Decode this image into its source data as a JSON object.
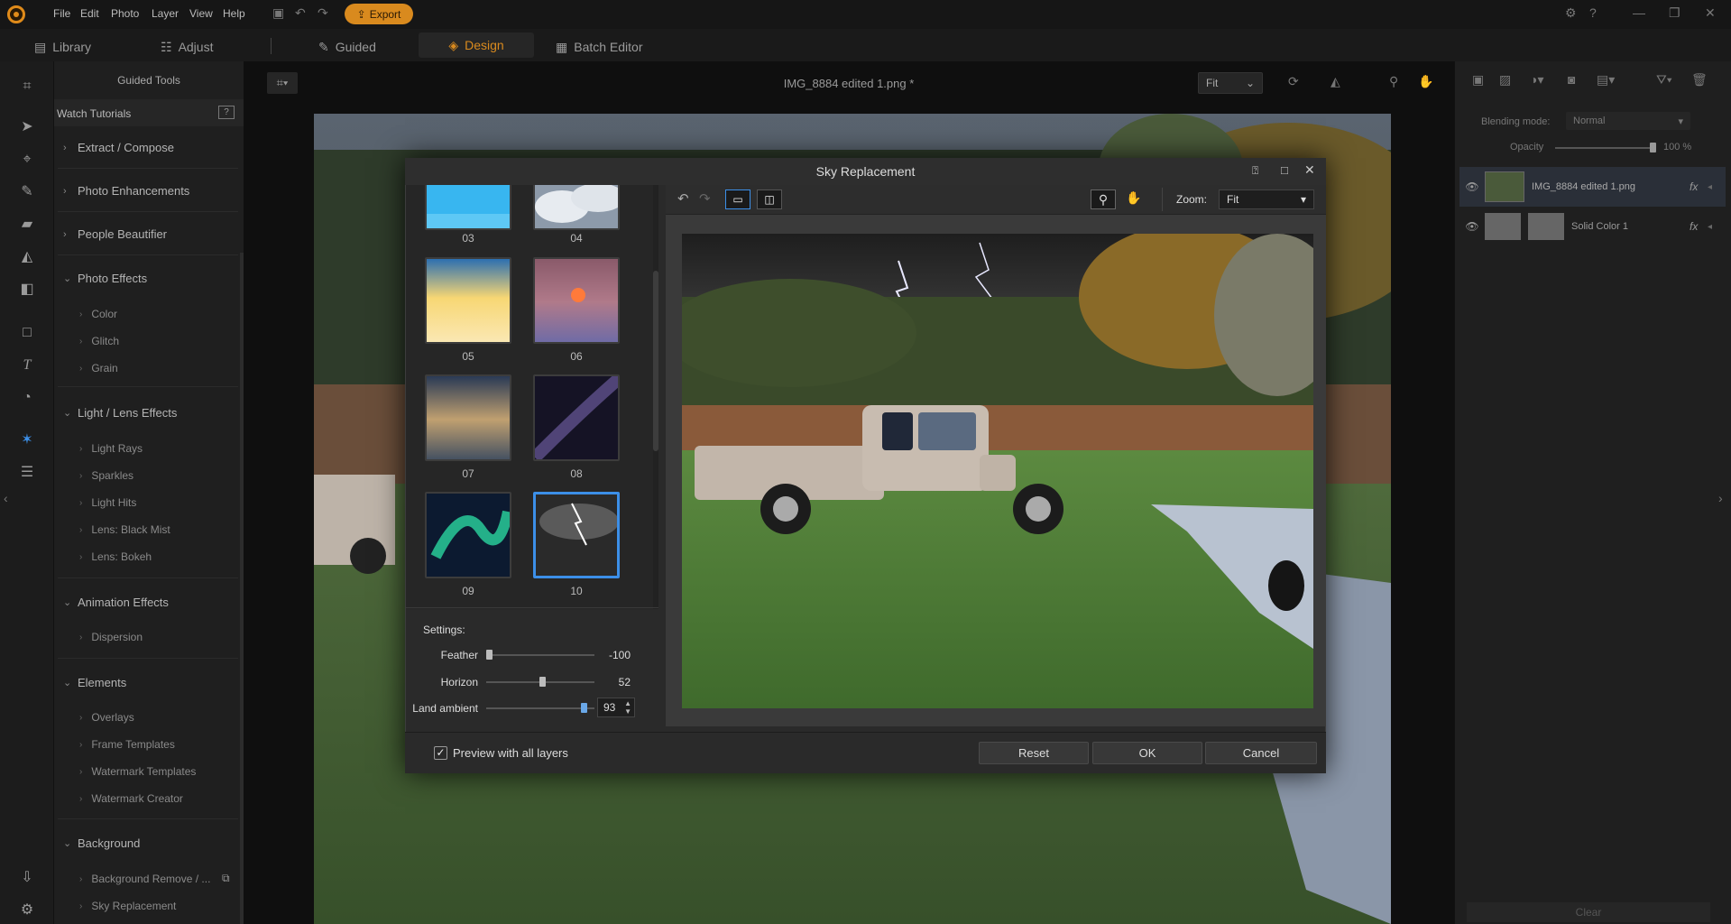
{
  "menu": [
    "File",
    "Edit",
    "Photo",
    "Layer",
    "View",
    "Help"
  ],
  "export_label": "Export",
  "tabs": {
    "library": "Library",
    "adjust": "Adjust",
    "guided": "Guided",
    "design": "Design",
    "batch": "Batch Editor"
  },
  "guided_panel": {
    "title": "Guided Tools",
    "watch": "Watch Tutorials",
    "sections": [
      {
        "label": "Extract / Compose",
        "expanded": false
      },
      {
        "label": "Photo Enhancements",
        "expanded": false
      },
      {
        "label": "People Beautifier",
        "expanded": false
      },
      {
        "label": "Photo Effects",
        "expanded": true
      },
      {
        "label": "Light / Lens Effects",
        "expanded": true
      },
      {
        "label": "Animation Effects",
        "expanded": true
      },
      {
        "label": "Elements",
        "expanded": true
      },
      {
        "label": "Background",
        "expanded": true
      }
    ],
    "photo_effects": [
      "Color",
      "Glitch",
      "Grain"
    ],
    "light_lens": [
      "Light Rays",
      "Sparkles",
      "Light Hits",
      "Lens: Black Mist",
      "Lens: Bokeh"
    ],
    "animation": [
      "Dispersion"
    ],
    "elements": [
      "Overlays",
      "Frame Templates",
      "Watermark Templates",
      "Watermark Creator"
    ],
    "background": [
      "Background Remove / ...",
      "Sky Replacement"
    ]
  },
  "canvas": {
    "file_title": "IMG_8884 edited 1.png *",
    "fit": "Fit"
  },
  "layers_panel": {
    "blending_label": "Blending mode:",
    "blending_value": "Normal",
    "opacity_label": "Opacity",
    "opacity_value": "100 %",
    "opacity": 100,
    "layers": [
      {
        "name": "IMG_8884 edited 1.png",
        "fx": "fx"
      },
      {
        "name": "Solid Color 1",
        "fx": "fx"
      }
    ],
    "clear": "Clear"
  },
  "dialog": {
    "title": "Sky Replacement",
    "skies": [
      "03",
      "04",
      "05",
      "06",
      "07",
      "08",
      "09",
      "10"
    ],
    "selected_sky": "10",
    "settings_label": "Settings:",
    "sliders": [
      {
        "label": "Feather",
        "value": "-100",
        "level": 0
      },
      {
        "label": "Horizon",
        "value": "52",
        "level": 52
      },
      {
        "label": "Land ambient",
        "value": "93",
        "level": 93
      }
    ],
    "zoom_label": "Zoom:",
    "zoom_value": "Fit",
    "preview_all_layers": "Preview with all layers",
    "preview_checked": true,
    "buttons": {
      "reset": "Reset",
      "ok": "OK",
      "cancel": "Cancel"
    }
  },
  "colors": {
    "accent": "#d98a1e",
    "selection": "#3c8fe8",
    "bg": "#141414"
  }
}
